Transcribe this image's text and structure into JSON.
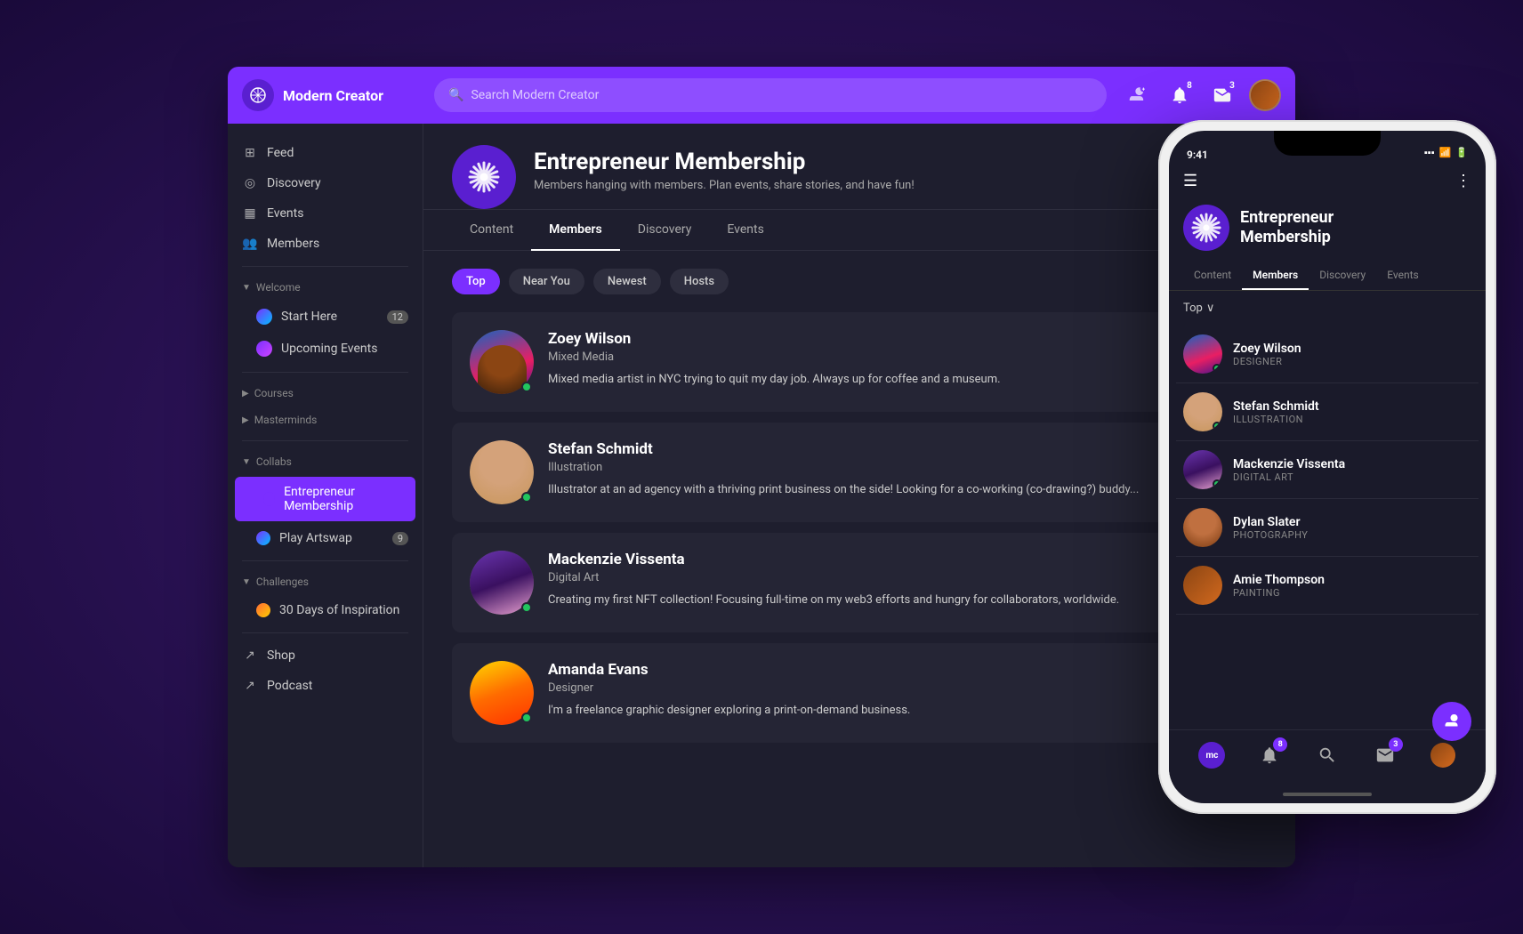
{
  "app": {
    "name": "Modern Creator",
    "logo_text": "mc",
    "search_placeholder": "Search Modern Creator"
  },
  "nav_icons": {
    "notifications_badge": "8",
    "alerts_badge": "3"
  },
  "sidebar": {
    "items": [
      {
        "id": "feed",
        "label": "Feed",
        "icon": "⊞"
      },
      {
        "id": "discovery",
        "label": "Discovery",
        "icon": "◎"
      },
      {
        "id": "events",
        "label": "Events",
        "icon": "▦"
      },
      {
        "id": "members",
        "label": "Members",
        "icon": "👥"
      }
    ],
    "sections": [
      {
        "title": "Welcome",
        "collapsed": false,
        "items": [
          {
            "id": "start-here",
            "label": "Start Here",
            "badge": "12"
          },
          {
            "id": "upcoming-events",
            "label": "Upcoming Events"
          }
        ]
      },
      {
        "title": "Courses",
        "collapsed": true,
        "items": []
      },
      {
        "title": "Masterminds",
        "collapsed": true,
        "items": []
      },
      {
        "title": "Collabs",
        "collapsed": false,
        "items": [
          {
            "id": "entrepreneur-membership",
            "label": "Entrepreneur Membership",
            "active": true
          },
          {
            "id": "play-artswap",
            "label": "Play Artswap",
            "badge": "9"
          }
        ]
      },
      {
        "title": "Challenges",
        "collapsed": false,
        "items": [
          {
            "id": "30-days",
            "label": "30 Days of Inspiration"
          }
        ]
      }
    ],
    "footer_items": [
      {
        "id": "shop",
        "label": "Shop",
        "icon": "↗"
      },
      {
        "id": "podcast",
        "label": "Podcast",
        "icon": "↗"
      }
    ]
  },
  "group": {
    "name": "Entrepreneur Membership",
    "subtitle": "Members hanging with members. Plan events, share stories, and have fun!",
    "tabs": [
      "Content",
      "Members",
      "Discovery",
      "Events"
    ],
    "active_tab": "Members",
    "filters": [
      "Top",
      "Near You",
      "Newest",
      "Hosts"
    ],
    "active_filter": "Top"
  },
  "members": [
    {
      "name": "Zoey Wilson",
      "role": "Mixed Media",
      "bio": "Mixed media artist in NYC trying to quit my day job. Always up for coffee and a museum.",
      "online": true,
      "avatar_class": "av-zoey",
      "phone_role": "DESIGNER"
    },
    {
      "name": "Stefan Schmidt",
      "role": "Illustration",
      "bio": "Illustrator at an ad agency with a thriving print business on the side! Looking for a co-working (co-drawing?) buddy...",
      "online": true,
      "avatar_class": "av-stefan",
      "phone_role": "ILLUSTRATION"
    },
    {
      "name": "Mackenzie Vissenta",
      "role": "Digital Art",
      "bio": "Creating my first NFT collection! Focusing full-time on my web3 efforts and hungry for collaborators, worldwide.",
      "online": true,
      "avatar_class": "av-mack",
      "phone_role": "DIGITAL ART"
    },
    {
      "name": "Amanda Evans",
      "role": "Designer",
      "bio": "I'm a freelance graphic designer exploring a print-on-demand business.",
      "online": true,
      "avatar_class": "av-amanda",
      "phone_role": "DESIGNER"
    }
  ],
  "phone": {
    "time": "9:41",
    "group_name_line1": "Entrepreneur",
    "group_name_line2": "Membership",
    "tabs": [
      "Content",
      "Members",
      "Discovery",
      "Events"
    ],
    "active_tab": "Members",
    "filter": "Top",
    "members": [
      {
        "name": "Zoey Wilson",
        "role": "DESIGNER",
        "online": true,
        "avatar_class": "face-zoey"
      },
      {
        "name": "Stefan Schmidt",
        "role": "ILLUSTRATION",
        "online": true,
        "avatar_class": "face-stefan"
      },
      {
        "name": "Mackenzie Vissenta",
        "role": "DIGITAL ART",
        "online": true,
        "avatar_class": "face-mack"
      },
      {
        "name": "Dylan Slater",
        "role": "PHOTOGRAPHY",
        "online": false,
        "avatar_class": "av-dylan"
      },
      {
        "name": "Amie Thompson",
        "role": "PAINTING",
        "online": false,
        "avatar_class": "av-amie"
      }
    ],
    "bottom_nav_badges": {
      "notifications": "8",
      "alerts": "3"
    }
  }
}
